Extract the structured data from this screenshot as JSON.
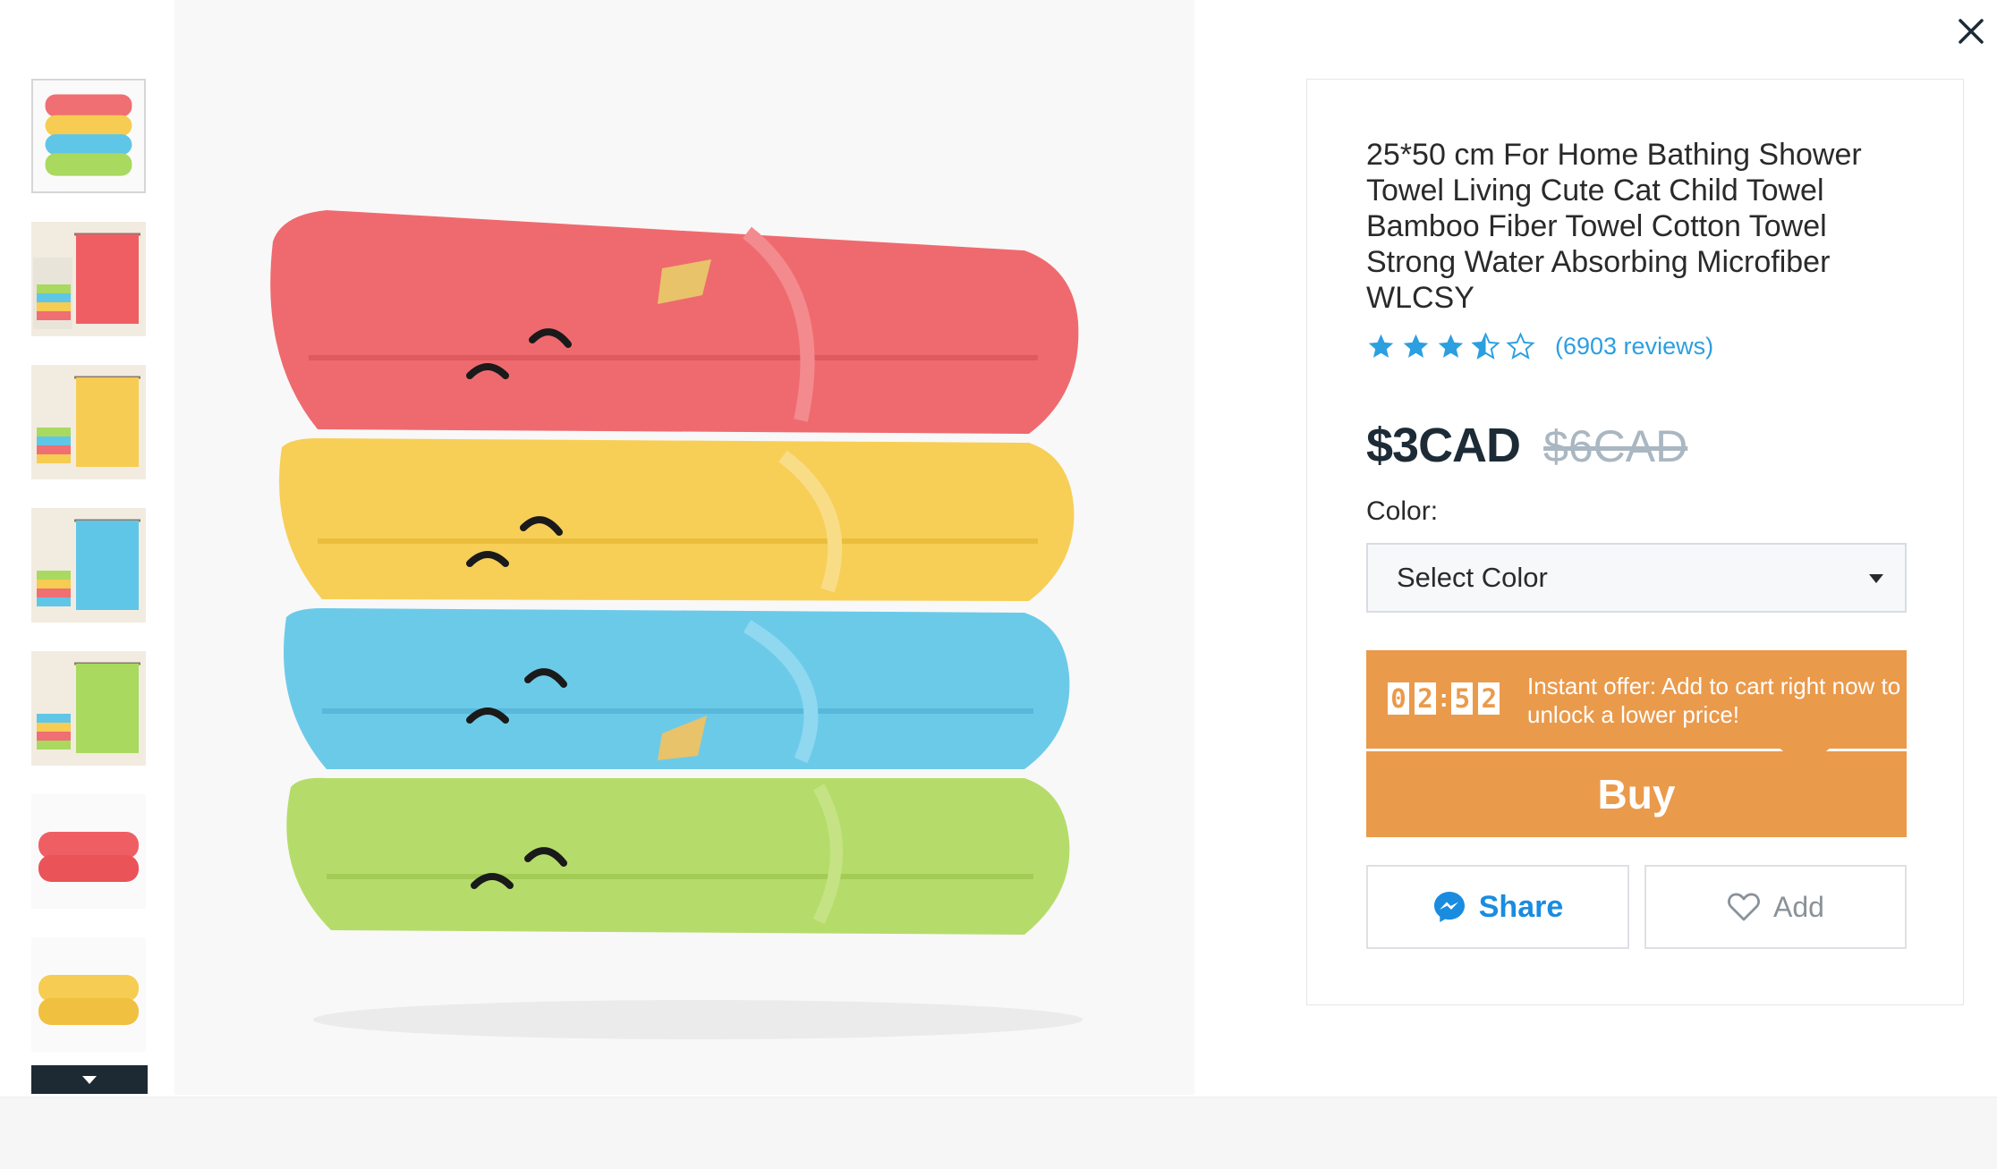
{
  "colors": {
    "accent": "#ea9a4b",
    "link": "#2b9fe0",
    "price": "#1c2b36",
    "original_price": "#a9b7c2"
  },
  "thumbnails": [
    {
      "name": "stacked-towels",
      "selected": true
    },
    {
      "name": "red-towel-hanging",
      "selected": false
    },
    {
      "name": "yellow-towel-hanging",
      "selected": false
    },
    {
      "name": "blue-towel-hanging",
      "selected": false
    },
    {
      "name": "green-towel-hanging",
      "selected": false
    },
    {
      "name": "red-towel-folded",
      "selected": false
    },
    {
      "name": "yellow-towel-folded",
      "selected": false
    }
  ],
  "product": {
    "title": "25*50 cm For Home Bathing Shower Towel Living Cute Cat Child Towel Bamboo Fiber Towel Cotton Towel Strong Water Absorbing Microfiber WLCSY",
    "rating": 3.5,
    "reviews": "(6903 reviews)",
    "price": "$3CAD",
    "original_price": "$6CAD"
  },
  "color_select": {
    "label": "Color:",
    "value": "Select Color"
  },
  "offer": {
    "timer": [
      "0",
      "2",
      "5",
      "2"
    ],
    "text": "Instant offer: Add to cart right now to unlock a lower price!"
  },
  "actions": {
    "buy": "Buy",
    "share": "Share",
    "add": "Add"
  },
  "icons": [
    "close-icon",
    "chevron-down-icon",
    "star-icon",
    "messenger-icon",
    "heart-icon"
  ]
}
